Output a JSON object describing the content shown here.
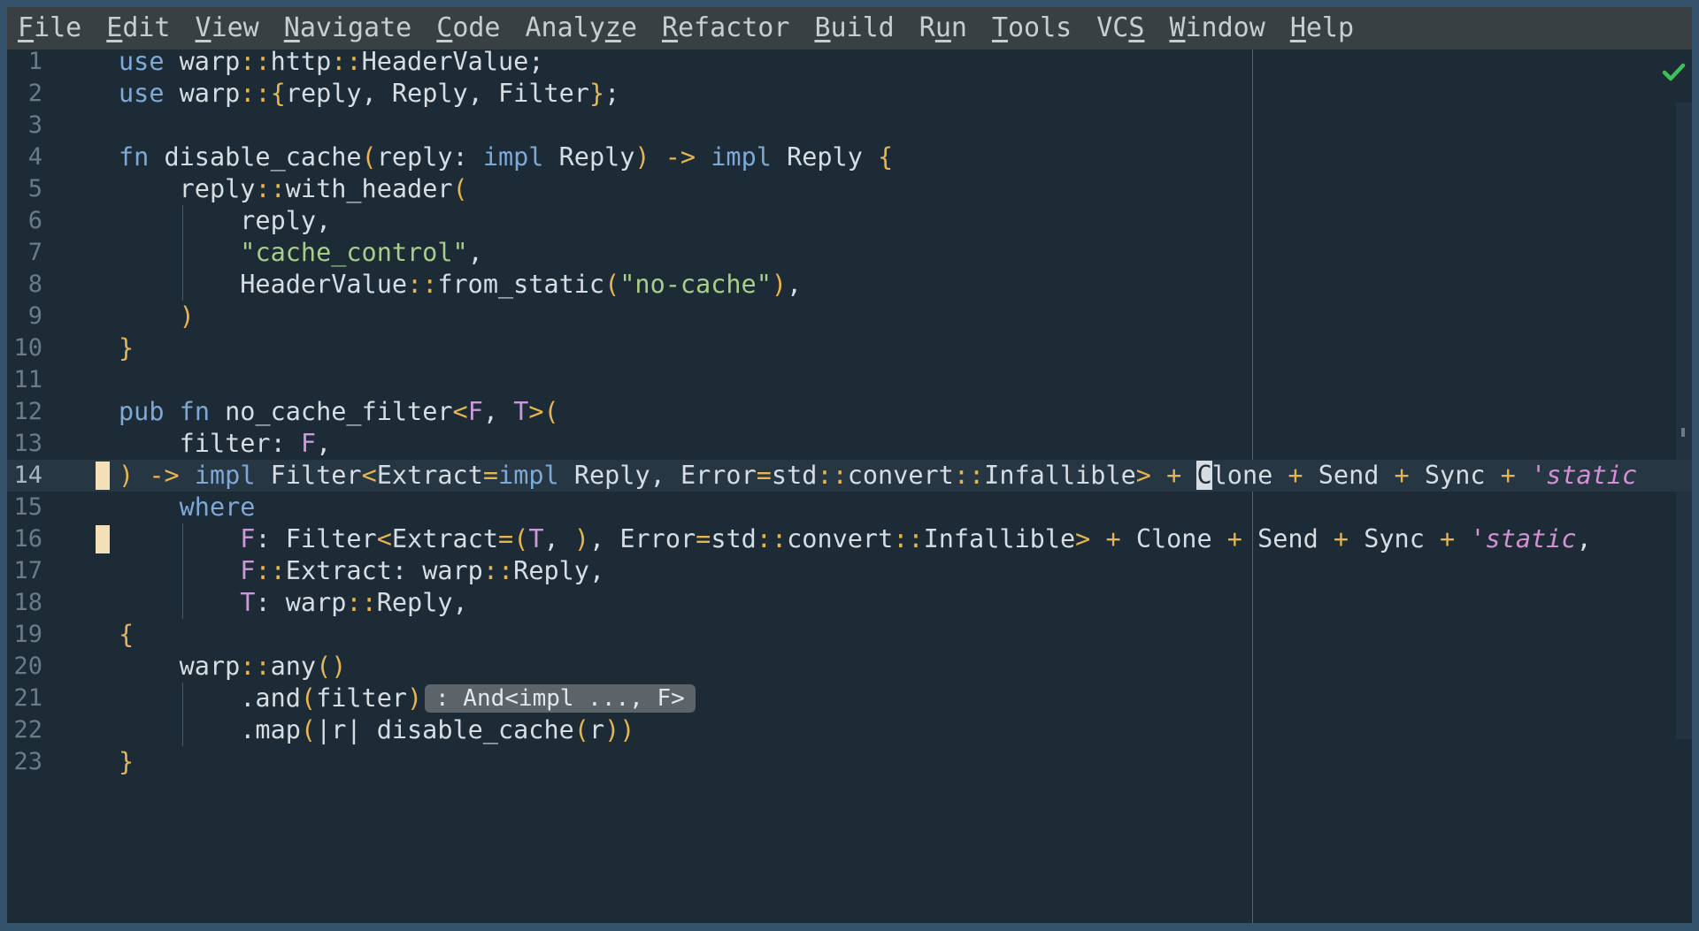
{
  "menubar": {
    "items": [
      {
        "mn": "F",
        "rest": "ile"
      },
      {
        "mn": "E",
        "rest": "dit"
      },
      {
        "mn": "V",
        "rest": "iew"
      },
      {
        "mn": "N",
        "rest": "avigate"
      },
      {
        "mn": "C",
        "rest": "ode"
      },
      {
        "pre": "Analy",
        "mn": "z",
        "rest": "e"
      },
      {
        "mn": "R",
        "rest": "efactor"
      },
      {
        "mn": "B",
        "rest": "uild"
      },
      {
        "pre": "R",
        "mn": "u",
        "rest": "n"
      },
      {
        "mn": "T",
        "rest": "ools"
      },
      {
        "pre": "VC",
        "mn": "S",
        "rest": ""
      },
      {
        "mn": "W",
        "rest": "indow"
      },
      {
        "mn": "H",
        "rest": "elp"
      }
    ]
  },
  "editor": {
    "current_line": 14,
    "inlay_hint": ": And<impl ..., F>",
    "status_icon": "check-icon",
    "colors": {
      "keyword": "#7ea8d6",
      "string": "#a8cf88",
      "brace": "#e6b450",
      "type_param": "#c99ad8",
      "lifetime": "#d58fd4",
      "background": "#1c2b36",
      "status_ok": "#3fbf5a"
    },
    "lines": [
      {
        "n": "1",
        "t": [
          [
            "kw",
            "use"
          ],
          [
            "pl",
            " warp"
          ],
          [
            "op",
            "::"
          ],
          [
            "pl",
            "http"
          ],
          [
            "op",
            "::"
          ],
          [
            "pl",
            "HeaderValue;"
          ]
        ]
      },
      {
        "n": "2",
        "t": [
          [
            "kw",
            "use"
          ],
          [
            "pl",
            " warp"
          ],
          [
            "op",
            "::"
          ],
          [
            "br",
            "{"
          ],
          [
            "pl",
            "reply, Reply, Filter"
          ],
          [
            "br",
            "}"
          ],
          [
            "pl",
            ";"
          ]
        ]
      },
      {
        "n": "3",
        "t": []
      },
      {
        "n": "4",
        "t": [
          [
            "kw",
            "fn"
          ],
          [
            "pl",
            " disable_cache"
          ],
          [
            "br",
            "("
          ],
          [
            "pl",
            "reply: "
          ],
          [
            "kw",
            "impl"
          ],
          [
            "pl",
            " Reply"
          ],
          [
            "br",
            ")"
          ],
          [
            "pl",
            " "
          ],
          [
            "op",
            "->"
          ],
          [
            "pl",
            " "
          ],
          [
            "kw",
            "impl"
          ],
          [
            "pl",
            " Reply "
          ],
          [
            "br",
            "{"
          ]
        ]
      },
      {
        "n": "5",
        "t": [
          [
            "pl",
            "    reply"
          ],
          [
            "op",
            "::"
          ],
          [
            "pl",
            "with_header"
          ],
          [
            "br",
            "("
          ]
        ]
      },
      {
        "n": "6",
        "t": [
          [
            "pl",
            "        reply,"
          ]
        ]
      },
      {
        "n": "7",
        "t": [
          [
            "pl",
            "        "
          ],
          [
            "str",
            "\"cache_control\""
          ],
          [
            "pl",
            ","
          ]
        ]
      },
      {
        "n": "8",
        "t": [
          [
            "pl",
            "        HeaderValue"
          ],
          [
            "op",
            "::"
          ],
          [
            "pl",
            "from_static"
          ],
          [
            "br",
            "("
          ],
          [
            "str",
            "\"no-cache\""
          ],
          [
            "br",
            ")"
          ],
          [
            "pl",
            ","
          ]
        ]
      },
      {
        "n": "9",
        "t": [
          [
            "pl",
            "    "
          ],
          [
            "br",
            ")"
          ]
        ]
      },
      {
        "n": "10",
        "t": [
          [
            "br",
            "}"
          ]
        ]
      },
      {
        "n": "11",
        "t": []
      },
      {
        "n": "12",
        "t": [
          [
            "kw",
            "pub"
          ],
          [
            "pl",
            " "
          ],
          [
            "kw",
            "fn"
          ],
          [
            "pl",
            " no_cache_filter"
          ],
          [
            "op",
            "<"
          ],
          [
            "tp",
            "F"
          ],
          [
            "pl",
            ", "
          ],
          [
            "tp",
            "T"
          ],
          [
            "op",
            ">"
          ],
          [
            "br",
            "("
          ]
        ]
      },
      {
        "n": "13",
        "t": [
          [
            "pl",
            "    filter: "
          ],
          [
            "tp",
            "F"
          ],
          [
            "pl",
            ","
          ]
        ]
      },
      {
        "n": "14",
        "t": [
          [
            "br",
            ")"
          ],
          [
            "pl",
            " "
          ],
          [
            "op",
            "->"
          ],
          [
            "pl",
            " "
          ],
          [
            "kw",
            "impl"
          ],
          [
            "pl",
            " Filter"
          ],
          [
            "op",
            "<"
          ],
          [
            "pl",
            "Extract"
          ],
          [
            "op",
            "="
          ],
          [
            "kw",
            "impl"
          ],
          [
            "pl",
            " Reply, Error"
          ],
          [
            "op",
            "="
          ],
          [
            "pl",
            "std"
          ],
          [
            "op",
            "::"
          ],
          [
            "pl",
            "convert"
          ],
          [
            "op",
            "::"
          ],
          [
            "pl",
            "Infallible"
          ],
          [
            "op",
            ">"
          ],
          [
            "pl",
            " "
          ],
          [
            "op",
            "+"
          ],
          [
            "pl",
            " "
          ],
          [
            "cur",
            "C"
          ],
          [
            "pl",
            "lone "
          ],
          [
            "op",
            "+"
          ],
          [
            "pl",
            " Send "
          ],
          [
            "op",
            "+"
          ],
          [
            "pl",
            " Sync "
          ],
          [
            "op",
            "+"
          ],
          [
            "pl",
            " "
          ],
          [
            "lt",
            "'static"
          ]
        ]
      },
      {
        "n": "15",
        "t": [
          [
            "pl",
            "    "
          ],
          [
            "kw",
            "where"
          ]
        ]
      },
      {
        "n": "16",
        "t": [
          [
            "pl",
            "        "
          ],
          [
            "tp",
            "F"
          ],
          [
            "pl",
            ": Filter"
          ],
          [
            "op",
            "<"
          ],
          [
            "pl",
            "Extract"
          ],
          [
            "op",
            "="
          ],
          [
            "br",
            "("
          ],
          [
            "tp",
            "T"
          ],
          [
            "pl",
            ", "
          ],
          [
            "br",
            ")"
          ],
          [
            "pl",
            ", Error"
          ],
          [
            "op",
            "="
          ],
          [
            "pl",
            "std"
          ],
          [
            "op",
            "::"
          ],
          [
            "pl",
            "convert"
          ],
          [
            "op",
            "::"
          ],
          [
            "pl",
            "Infallible"
          ],
          [
            "op",
            ">"
          ],
          [
            "pl",
            " "
          ],
          [
            "op",
            "+"
          ],
          [
            "pl",
            " Clone "
          ],
          [
            "op",
            "+"
          ],
          [
            "pl",
            " Send "
          ],
          [
            "op",
            "+"
          ],
          [
            "pl",
            " Sync "
          ],
          [
            "op",
            "+"
          ],
          [
            "pl",
            " "
          ],
          [
            "lt",
            "'static"
          ],
          [
            "pl",
            ","
          ]
        ]
      },
      {
        "n": "17",
        "t": [
          [
            "pl",
            "        "
          ],
          [
            "tp",
            "F"
          ],
          [
            "op",
            "::"
          ],
          [
            "pl",
            "Extract: warp"
          ],
          [
            "op",
            "::"
          ],
          [
            "pl",
            "Reply,"
          ]
        ]
      },
      {
        "n": "18",
        "t": [
          [
            "pl",
            "        "
          ],
          [
            "tp",
            "T"
          ],
          [
            "pl",
            ": warp"
          ],
          [
            "op",
            "::"
          ],
          [
            "pl",
            "Reply,"
          ]
        ]
      },
      {
        "n": "19",
        "t": [
          [
            "br",
            "{"
          ]
        ]
      },
      {
        "n": "20",
        "t": [
          [
            "pl",
            "    warp"
          ],
          [
            "op",
            "::"
          ],
          [
            "pl",
            "any"
          ],
          [
            "br",
            "()"
          ]
        ]
      },
      {
        "n": "21",
        "t": [
          [
            "pl",
            "        .and"
          ],
          [
            "br",
            "("
          ],
          [
            "pl",
            "filter"
          ],
          [
            "br",
            ")"
          ]
        ]
      },
      {
        "n": "22",
        "t": [
          [
            "pl",
            "        .map"
          ],
          [
            "br",
            "("
          ],
          [
            "pl",
            "|r| disable_cache"
          ],
          [
            "br",
            "("
          ],
          [
            "pl",
            "r"
          ],
          [
            "br",
            "))"
          ]
        ]
      },
      {
        "n": "23",
        "t": [
          [
            "br",
            "}"
          ]
        ]
      }
    ]
  }
}
